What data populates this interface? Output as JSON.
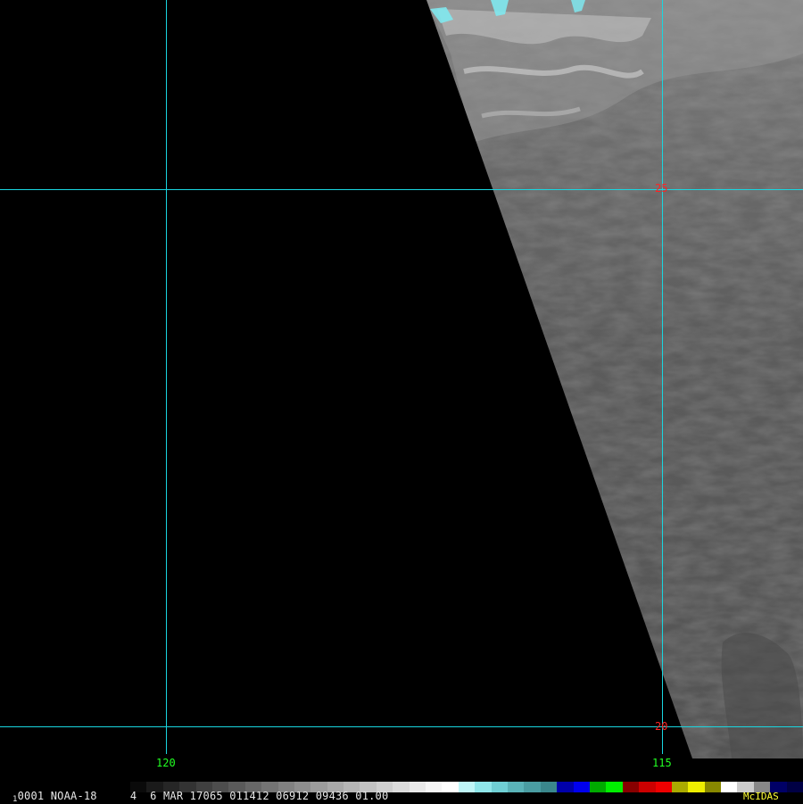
{
  "image": {
    "satellite": "NOAA-18",
    "frame_number": "1",
    "status_line": "0001 NOAA-18     4  6 MAR 17065 011412 06912 09436 01.00",
    "software_label": "McIDAS"
  },
  "grid": {
    "line_color": "#19d6e0",
    "longitudes": [
      {
        "label": "120",
        "value": 120
      },
      {
        "label": "115",
        "value": 115
      }
    ],
    "latitudes": [
      {
        "label": "25",
        "value": 25
      },
      {
        "label": "20",
        "value": 20
      }
    ],
    "lon_label_color": "#22ff22",
    "lat_label_color": "#ff2222"
  },
  "enhancement_colors": {
    "background": "#000000",
    "swath_base": "#5a5a5a",
    "cloud_bright": "#d8d8d8",
    "cloud_cold": "#7fe8ee"
  },
  "color_bar": [
    "#0a0a0a",
    "#1a1a1a",
    "#262626",
    "#333333",
    "#404040",
    "#4d4d4d",
    "#5a5a5a",
    "#676767",
    "#747474",
    "#818181",
    "#8e8e8e",
    "#9b9b9b",
    "#a8a8a8",
    "#b5b5b5",
    "#c2c2c2",
    "#cfcfcf",
    "#dcdcdc",
    "#e9e9e9",
    "#f6f6f6",
    "#ffffff",
    "#bff6f8",
    "#8fe6ea",
    "#6fcfd4",
    "#5ab3b8",
    "#4a9da2",
    "#3a878c",
    "#0000aa",
    "#0000ee",
    "#00aa00",
    "#00ee00",
    "#880000",
    "#cc0000",
    "#ee0000",
    "#aaaa00",
    "#eeee00",
    "#888800",
    "#ffffff",
    "#cccccc",
    "#888888",
    "#000066",
    "#000044"
  ]
}
